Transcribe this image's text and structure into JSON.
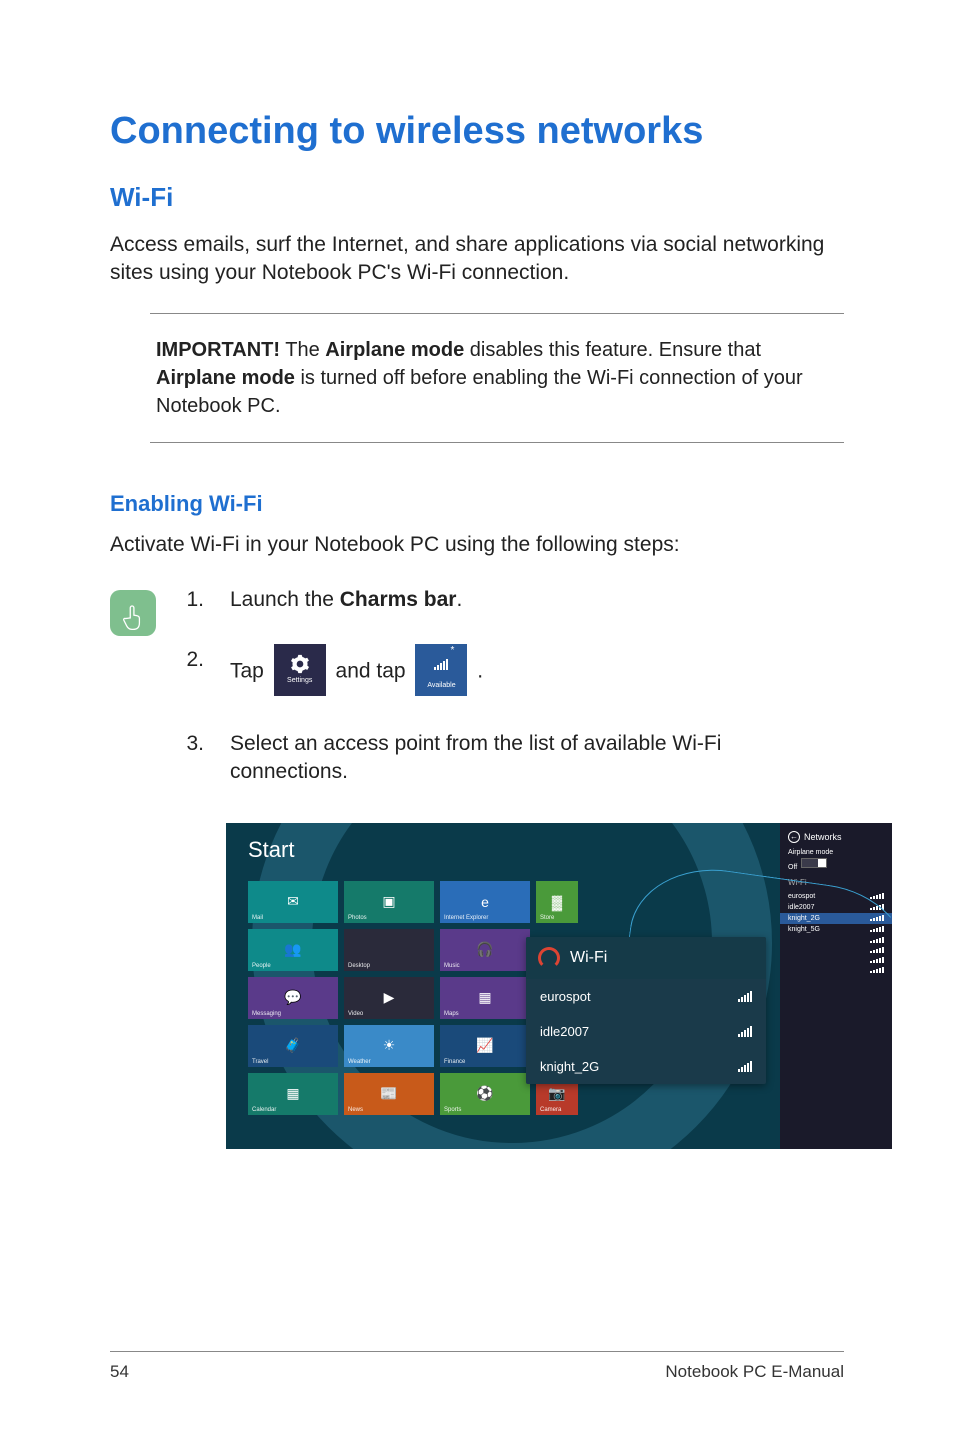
{
  "title": "Connecting to wireless networks",
  "section": "Wi-Fi",
  "intro": "Access emails, surf the Internet, and share applications via social networking sites using your Notebook PC's Wi-Fi connection.",
  "important_label": "IMPORTANT!",
  "important_part1": " The ",
  "important_bold1": "Airplane mode",
  "important_part2": " disables this feature. Ensure that ",
  "important_bold2": "Airplane mode",
  "important_part3": " is turned off before enabling the Wi-Fi connection of your Notebook PC.",
  "subsection": "Enabling Wi-Fi",
  "lead": "Activate Wi-Fi in your Notebook PC using the following steps:",
  "steps": {
    "s1_num": "1.",
    "s1_a": "Launch the ",
    "s1_b": "Charms bar",
    "s1_c": ".",
    "s2_num": "2.",
    "s2_a": "Tap ",
    "s2_b": " and tap ",
    "s2_c": ".",
    "settings_label": "Settings",
    "available_label": "Available",
    "s3_num": "3.",
    "s3": "Select an access point from the list of available Wi-Fi connections."
  },
  "screenshot": {
    "start": "Start",
    "networks_title": "Networks",
    "airplane_label": "Airplane mode",
    "airplane_state": "Off",
    "wifi_section": "Wi-Fi",
    "panel_aps": [
      "eurospot",
      "idle2007",
      "knight_2G",
      "knight_5G",
      "",
      "",
      "",
      ""
    ],
    "popup_title": "Wi-Fi",
    "popup_items": [
      "eurospot",
      "idle2007",
      "knight_2G"
    ],
    "tiles": [
      {
        "label": "Mail",
        "cls": "c-teal"
      },
      {
        "label": "Photos",
        "cls": "c-teal2"
      },
      {
        "label": "Internet Explorer",
        "cls": "c-blue"
      },
      {
        "label": "Store",
        "cls": "c-green",
        "half": true
      },
      {
        "label": "People",
        "cls": "c-teal"
      },
      {
        "label": "Desktop",
        "cls": "c-dark"
      },
      {
        "label": "Music",
        "cls": "c-purple"
      },
      {
        "label": "",
        "cls": "",
        "half": true,
        "empty": true
      },
      {
        "label": "Messaging",
        "cls": "c-purple",
        "halfpair": true
      },
      {
        "label": "Video",
        "cls": "c-dark"
      },
      {
        "label": "Maps",
        "cls": "c-purple"
      },
      {
        "label": "",
        "cls": "",
        "half": true,
        "empty": true
      },
      {
        "label": "Travel",
        "cls": "c-dkblue"
      },
      {
        "label": "Weather",
        "cls": "c-ltblue"
      },
      {
        "label": "Finance",
        "cls": "c-dkblue"
      },
      {
        "label": "",
        "cls": "",
        "half": true,
        "empty": true
      },
      {
        "label": "Calendar",
        "cls": "c-teal2"
      },
      {
        "label": "News",
        "cls": "c-orange"
      },
      {
        "label": "Sports",
        "cls": "c-green"
      },
      {
        "label": "Camera",
        "cls": "c-red",
        "half": true
      }
    ]
  },
  "footer": {
    "page": "54",
    "title": "Notebook PC E-Manual"
  }
}
